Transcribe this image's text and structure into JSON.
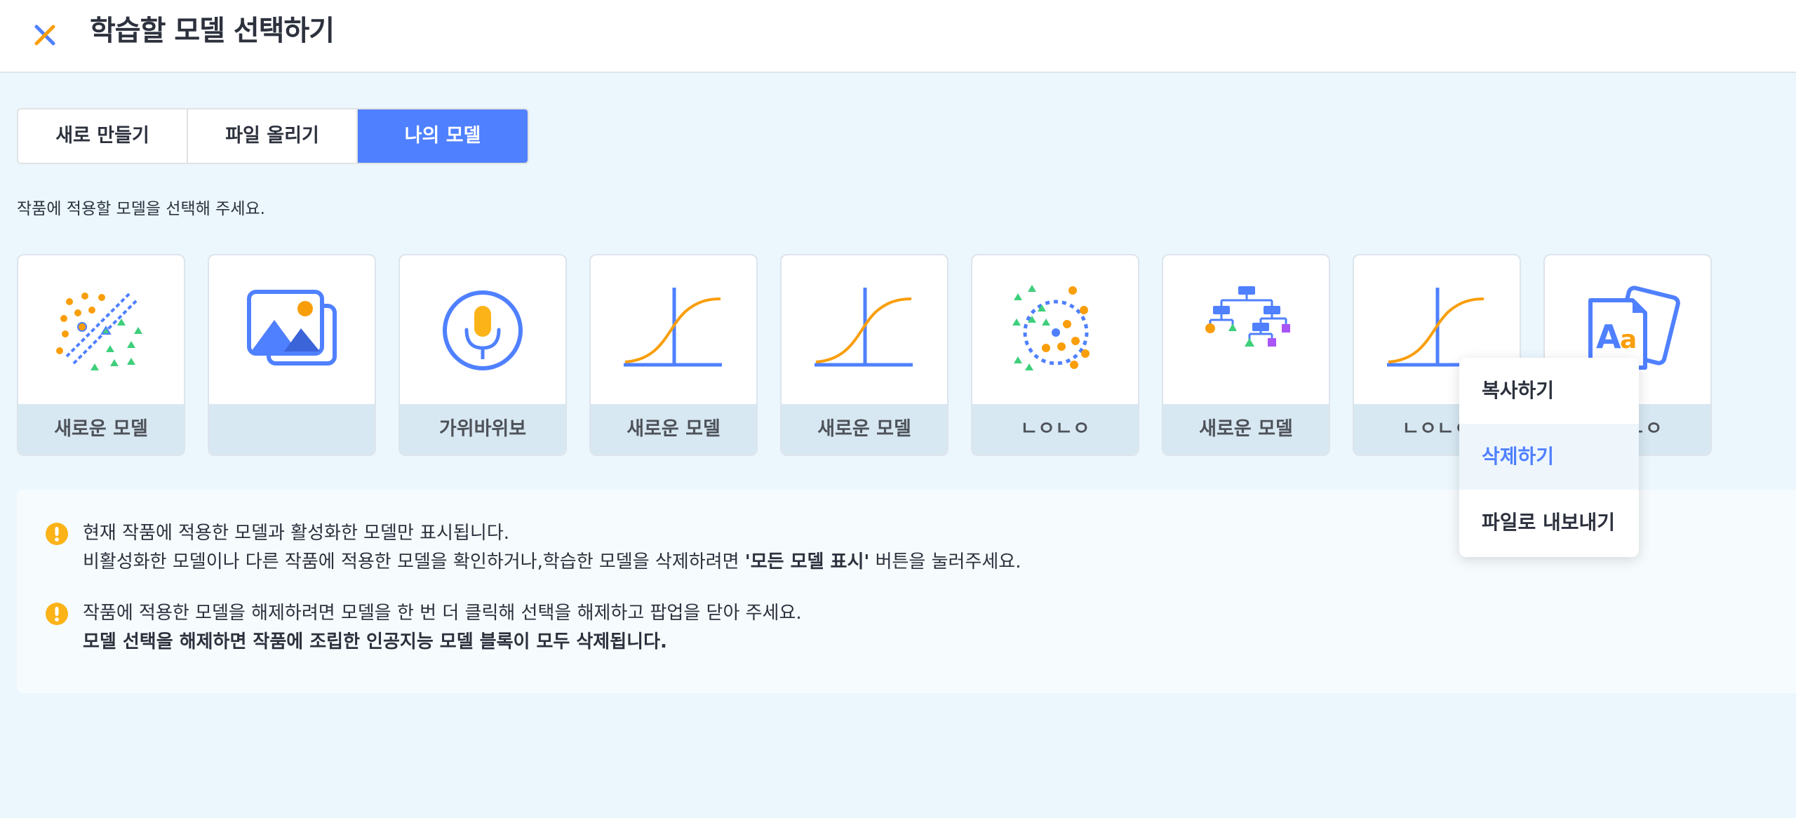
{
  "header": {
    "title": "학습할 모델 선택하기",
    "close_icon": "close-x-icon"
  },
  "tabs": [
    {
      "label": "새로 만들기",
      "active": false
    },
    {
      "label": "파일 올리기",
      "active": false
    },
    {
      "label": "나의 모델",
      "active": true
    }
  ],
  "instruction": "작품에 적용할 모델을 선택해 주세요.",
  "cards": [
    {
      "icon": "classification-scatter-icon",
      "label": "새로운 모델"
    },
    {
      "icon": "image-icon",
      "label": ""
    },
    {
      "icon": "microphone-icon",
      "label": "가위바위보"
    },
    {
      "icon": "regression-curve-icon",
      "label": "새로운 모델"
    },
    {
      "icon": "regression-curve-icon",
      "label": "새로운 모델"
    },
    {
      "icon": "clustering-icon",
      "label": "ㄴㅇㄴㅇ"
    },
    {
      "icon": "decision-tree-icon",
      "label": "새로운 모델"
    },
    {
      "icon": "regression-curve-icon",
      "label": "ㄴㅇㄴㅇ"
    },
    {
      "icon": "text-aa-icon",
      "label": "ㄴㅇㄴㅇ"
    }
  ],
  "notices": [
    {
      "icon": "warning-icon",
      "line1": "현재 작품에 적용한 모델과 활성화한 모델만 표시됩니다.",
      "line2_before": "비활성화한 모델이나 다른 작품에 적용한 모델을 확인하거나,학습한 모델을 삭제하려면 ",
      "line2_bold": "'모든 모델 표시'",
      "line2_after": " 버튼을 눌러주세요."
    },
    {
      "icon": "warning-icon",
      "line1": "작품에 적용한 모델을 해제하려면 모델을 한 번 더 클릭해 선택을 해제하고 팝업을 닫아 주세요.",
      "line2_bold": "모델 선택을 해제하면 작품에 조립한 인공지능 모델 블록이 모두 삭제됩니다."
    }
  ],
  "context_menu": [
    {
      "label": "복사하기",
      "highlighted": false
    },
    {
      "label": "삭제하기",
      "highlighted": true
    },
    {
      "label": "파일로 내보내기",
      "highlighted": false
    }
  ],
  "colors": {
    "accent": "#4f80ff",
    "orange": "#f99e0b",
    "green": "#3ecf7b",
    "purple": "#a955f7",
    "warning": "#fbb318",
    "background": "#ebf7fd"
  }
}
